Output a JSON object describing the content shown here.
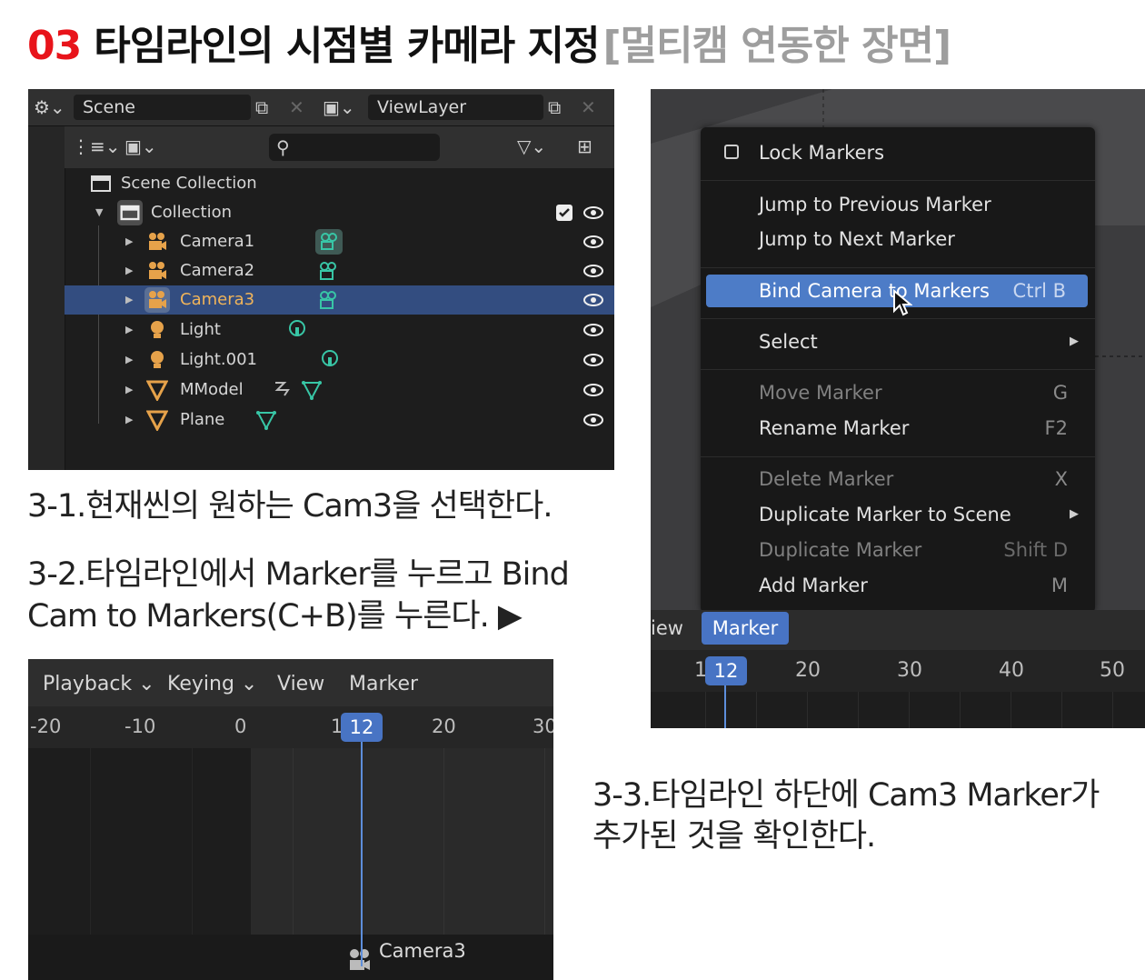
{
  "title": {
    "number": "03",
    "main": "타임라인의 시점별 카메라 지정",
    "sub": "[멀티캠 연동한 장면]"
  },
  "captions": {
    "step1": "3-1.현재씬의 원하는 Cam3을 선택한다.",
    "step2_line1": "3-2.타임라인에서 Marker를 누르고 Bind",
    "step2_line2": "Cam to Markers(C+B)를 누른다. ▶",
    "step3_line1": "3-3.타임라인 하단에 Cam3 Marker가",
    "step3_line2": "추가된 것을 확인한다."
  },
  "outliner": {
    "scene_label": "Scene",
    "viewlayer_label": "ViewLayer",
    "scene_collection": "Scene Collection",
    "collection": "Collection",
    "items": [
      {
        "label": "Camera1",
        "type": "camera"
      },
      {
        "label": "Camera2",
        "type": "camera"
      },
      {
        "label": "Camera3",
        "type": "camera",
        "selected": true
      },
      {
        "label": "Light",
        "type": "light"
      },
      {
        "label": "Light.001",
        "type": "light"
      },
      {
        "label": "MModel",
        "type": "mesh"
      },
      {
        "label": "Plane",
        "type": "mesh"
      }
    ]
  },
  "timeline": {
    "menus": [
      "Playback",
      "Keying",
      "View",
      "Marker"
    ],
    "ruler": [
      "-20",
      "-10",
      "0",
      "1",
      "20",
      "30"
    ],
    "current_frame": "12",
    "marker_label": "Camera3"
  },
  "marker_menu": {
    "lock_markers": "Lock Markers",
    "jump_prev": "Jump to Previous Marker",
    "jump_next": "Jump to Next Marker",
    "bind_camera": "Bind Camera to Markers",
    "bind_camera_key": "Ctrl B",
    "select": "Select",
    "move_marker": "Move Marker",
    "move_marker_key": "G",
    "rename_marker": "Rename Marker",
    "rename_marker_key": "F2",
    "delete_marker": "Delete Marker",
    "delete_marker_key": "X",
    "dup_to_scene": "Duplicate Marker to Scene",
    "dup_marker": "Duplicate Marker",
    "dup_marker_key": "Shift D",
    "add_marker": "Add Marker",
    "add_marker_key": "M"
  },
  "right_timeline": {
    "view_tab": "iew",
    "marker_tab": "Marker",
    "ruler": [
      "1",
      "20",
      "30",
      "40",
      "50"
    ],
    "current_frame": "12"
  },
  "colors": {
    "title_number": "#e8141b",
    "selection": "#334d80",
    "highlight": "#4d7cc7",
    "camera_icon": "#e6a24a",
    "data_icon": "#38c6a6"
  }
}
